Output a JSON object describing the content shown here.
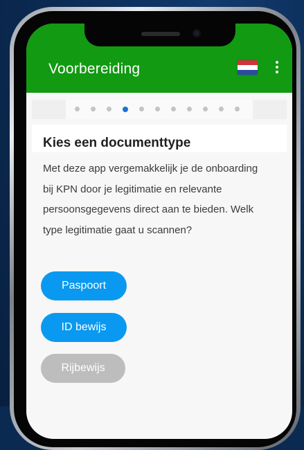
{
  "appbar": {
    "title": "Voorbereiding",
    "language_flag": "netherlands-flag-icon",
    "menu_icon": "more-vertical-icon",
    "color": "#129a12"
  },
  "stepper": {
    "total_steps": 11,
    "active_step": 4,
    "active_color": "#1a73d9",
    "inactive_color": "#c4c4c4"
  },
  "content": {
    "heading": "Kies een documenttype",
    "description": "Met deze app vergemakkelijk je de onboarding bij KPN door je legitimatie en relevante persoonsgegevens direct aan te bieden. Welk type legitimatie gaat u scannen?"
  },
  "buttons": {
    "paspoort": "Paspoort",
    "id_bewijs": "ID bewijs",
    "rijbewijs": "Rijbewijs",
    "primary_color": "#0a99f0",
    "disabled_color": "#bdbdbd"
  }
}
